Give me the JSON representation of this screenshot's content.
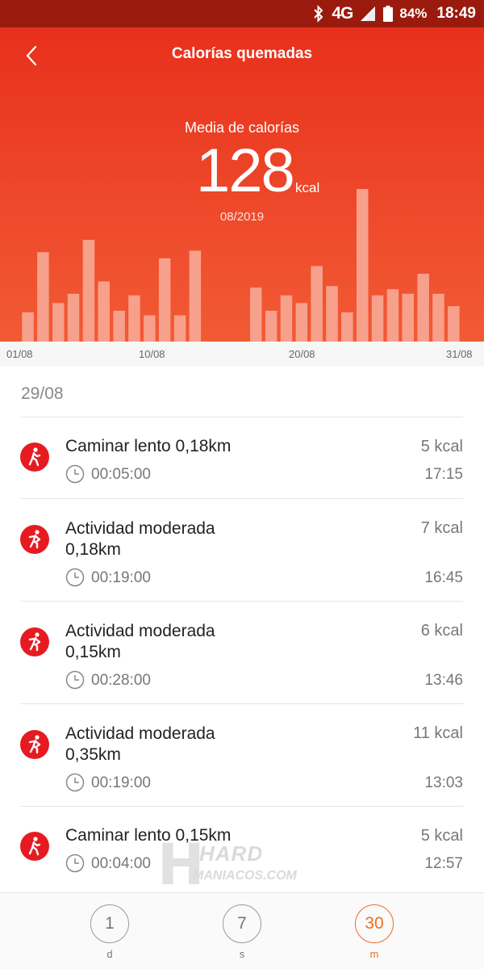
{
  "status_bar": {
    "network": "4G",
    "network_small": "4G",
    "battery": "84%",
    "time": "18:49"
  },
  "header": {
    "title": "Calorías quemadas"
  },
  "summary": {
    "label": "Media de calorías",
    "value": "128",
    "unit": "kcal",
    "period": "08/2019"
  },
  "chart_data": {
    "type": "bar",
    "categories": [
      "01/08",
      "02/08",
      "03/08",
      "04/08",
      "05/08",
      "06/08",
      "07/08",
      "08/08",
      "09/08",
      "10/08",
      "11/08",
      "12/08",
      "13/08",
      "14/08",
      "15/08",
      "16/08",
      "17/08",
      "18/08",
      "19/08",
      "20/08",
      "21/08",
      "22/08",
      "23/08",
      "24/08",
      "25/08",
      "26/08",
      "27/08",
      "28/08",
      "29/08",
      "30/08",
      "31/08"
    ],
    "values": [
      19,
      58,
      25,
      31,
      66,
      39,
      20,
      30,
      17,
      54,
      17,
      59,
      0,
      0,
      0,
      35,
      20,
      30,
      25,
      49,
      36,
      19,
      99,
      30,
      34,
      31,
      44,
      31,
      23,
      0,
      0
    ],
    "x_tick_labels": [
      "01/08",
      "10/08",
      "20/08",
      "31/08"
    ],
    "ylim": [
      0,
      110
    ],
    "grid": false,
    "bar_color": "#f7a08c"
  },
  "day": {
    "date": "29/08"
  },
  "activities": [
    {
      "name_line1": "Caminar lento 0,18km",
      "name_line2": "",
      "kcal": "5 kcal",
      "duration": "00:05:00",
      "time": "17:15",
      "icon": "walking-icon"
    },
    {
      "name_line1": "Actividad moderada",
      "name_line2": "0,18km",
      "kcal": "7 kcal",
      "duration": "00:19:00",
      "time": "16:45",
      "icon": "moderate-activity-icon"
    },
    {
      "name_line1": "Actividad moderada",
      "name_line2": "0,15km",
      "kcal": "6 kcal",
      "duration": "00:28:00",
      "time": "13:46",
      "icon": "moderate-activity-icon"
    },
    {
      "name_line1": "Actividad moderada",
      "name_line2": "0,35km",
      "kcal": "11 kcal",
      "duration": "00:19:00",
      "time": "13:03",
      "icon": "moderate-activity-icon"
    },
    {
      "name_line1": "Caminar lento 0,15km",
      "name_line2": "",
      "kcal": "5 kcal",
      "duration": "00:04:00",
      "time": "12:57",
      "icon": "walking-icon"
    }
  ],
  "watermark": {
    "brand_top": "HARD",
    "brand_bottom": "MANIACOS.COM",
    "letter": "H"
  },
  "bottom_nav": [
    {
      "value": "1",
      "label": "d",
      "active": false
    },
    {
      "value": "7",
      "label": "s",
      "active": false
    },
    {
      "value": "30",
      "label": "m",
      "active": true
    }
  ],
  "colors": {
    "accent": "#e8301c",
    "nav_active": "#f26b22",
    "status_bar": "#9b1a0e",
    "icon_red": "#e61b22"
  }
}
